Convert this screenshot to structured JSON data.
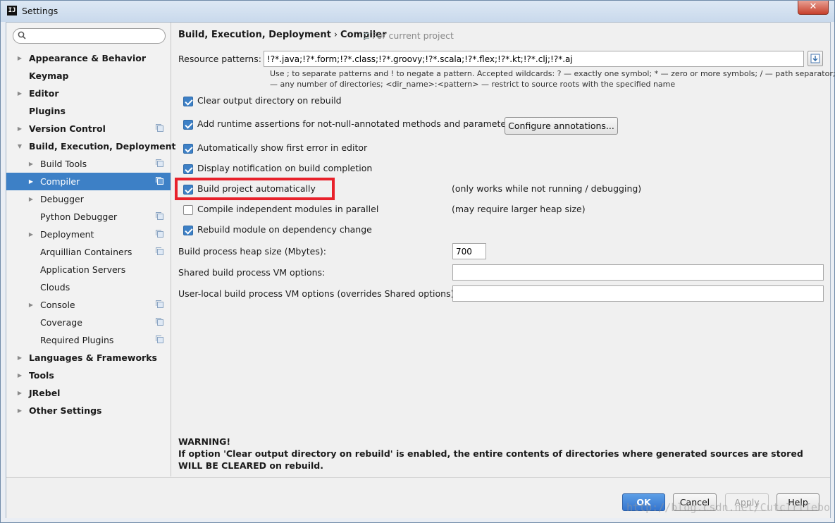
{
  "window": {
    "title": "Settings",
    "close_glyph": "✕"
  },
  "search": {
    "placeholder": "",
    "value": ""
  },
  "sidebar": {
    "items": [
      {
        "label": "Appearance & Behavior",
        "arrow": "▶",
        "bold": true,
        "copy": false
      },
      {
        "label": "Keymap",
        "arrow": "",
        "bold": true,
        "copy": false
      },
      {
        "label": "Editor",
        "arrow": "▶",
        "bold": true,
        "copy": false
      },
      {
        "label": "Plugins",
        "arrow": "",
        "bold": true,
        "copy": false
      },
      {
        "label": "Version Control",
        "arrow": "▶",
        "bold": true,
        "copy": true
      },
      {
        "label": "Build, Execution, Deployment",
        "arrow": "▼",
        "bold": true,
        "copy": false
      },
      {
        "label": "Build Tools",
        "arrow": "▶",
        "bold": false,
        "copy": true,
        "indent": 1
      },
      {
        "label": "Compiler",
        "arrow": "▶",
        "bold": false,
        "copy": true,
        "indent": 1,
        "selected": true
      },
      {
        "label": "Debugger",
        "arrow": "▶",
        "bold": false,
        "copy": false,
        "indent": 1
      },
      {
        "label": "Python Debugger",
        "arrow": "",
        "bold": false,
        "copy": true,
        "indent": 1
      },
      {
        "label": "Deployment",
        "arrow": "▶",
        "bold": false,
        "copy": true,
        "indent": 1
      },
      {
        "label": "Arquillian Containers",
        "arrow": "",
        "bold": false,
        "copy": true,
        "indent": 1
      },
      {
        "label": "Application Servers",
        "arrow": "",
        "bold": false,
        "copy": false,
        "indent": 1
      },
      {
        "label": "Clouds",
        "arrow": "",
        "bold": false,
        "copy": false,
        "indent": 1
      },
      {
        "label": "Console",
        "arrow": "▶",
        "bold": false,
        "copy": true,
        "indent": 1
      },
      {
        "label": "Coverage",
        "arrow": "",
        "bold": false,
        "copy": true,
        "indent": 1
      },
      {
        "label": "Required Plugins",
        "arrow": "",
        "bold": false,
        "copy": true,
        "indent": 1
      },
      {
        "label": "Languages & Frameworks",
        "arrow": "▶",
        "bold": true,
        "copy": false
      },
      {
        "label": "Tools",
        "arrow": "▶",
        "bold": true,
        "copy": false
      },
      {
        "label": "JRebel",
        "arrow": "▶",
        "bold": true,
        "copy": false
      },
      {
        "label": "Other Settings",
        "arrow": "▶",
        "bold": true,
        "copy": false
      }
    ]
  },
  "main": {
    "breadcrumb": {
      "parent": "Build, Execution, Deployment",
      "separator": "›",
      "current": "Compiler",
      "note": "For current project"
    },
    "resource_patterns": {
      "label": "Resource patterns:",
      "value": "!?*.java;!?*.form;!?*.class;!?*.groovy;!?*.scala;!?*.flex;!?*.kt;!?*.clj;!?*.aj",
      "hint_line1": "Use ; to separate patterns and ! to negate a pattern. Accepted wildcards: ? — exactly one symbol; * — zero or more symbols; / — path separator; /**/",
      "hint_line2": "— any number of directories; <dir_name>:<pattern> — restrict to source roots with the specified name"
    },
    "options": [
      {
        "label": "Clear output directory on rebuild",
        "checked": true
      },
      {
        "label": "Add runtime assertions for not-null-annotated methods and parameters",
        "checked": true
      },
      {
        "label": "Automatically show first error in editor",
        "checked": true
      },
      {
        "label": "Display notification on build completion",
        "checked": true
      },
      {
        "label": "Build project automatically",
        "checked": true,
        "note": "(only works while not running / debugging)"
      },
      {
        "label": "Compile independent modules in parallel",
        "checked": false,
        "note": "(may require larger heap size)"
      },
      {
        "label": "Rebuild module on dependency change",
        "checked": true
      }
    ],
    "configure_button": "Configure annotations...",
    "heap": {
      "label": "Build process heap size (Mbytes):",
      "value": "700"
    },
    "shared_vm": {
      "label": "Shared build process VM options:",
      "value": ""
    },
    "user_vm": {
      "label": "User-local build process VM options (overrides Shared options):",
      "value": ""
    },
    "warning": {
      "title": "WARNING!",
      "text": "If option 'Clear output directory on rebuild' is enabled, the entire contents of directories where generated sources are stored WILL BE CLEARED on rebuild."
    }
  },
  "footer": {
    "ok": "OK",
    "cancel": "Cancel",
    "apply": "Apply",
    "help": "Help"
  },
  "watermark": "http://blog.csdn.net/CutcIrtIebo",
  "colors": {
    "selection": "#3d80c6",
    "highlight": "#e8212b",
    "primary": "#3575cf"
  }
}
